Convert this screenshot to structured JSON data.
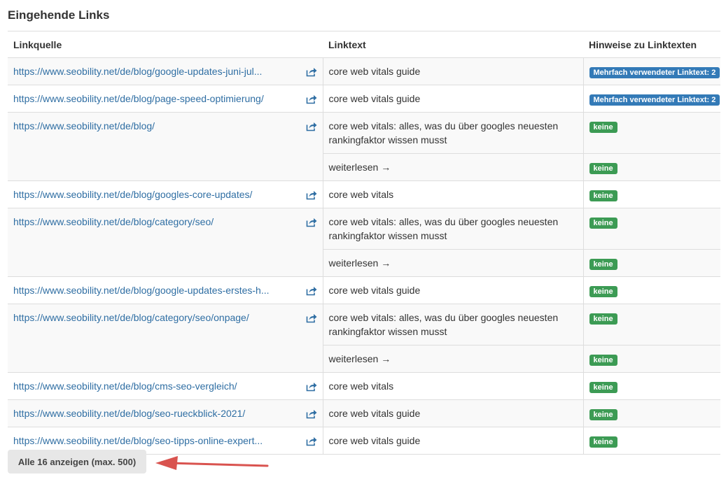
{
  "section": {
    "title": "Eingehende Links"
  },
  "table": {
    "headers": [
      "Linkquelle",
      "Linktext",
      "Hinweise zu Linktexten"
    ],
    "rows": [
      {
        "source": "https://www.seobility.net/de/blog/google-updates-juni-jul...",
        "entries": [
          {
            "text": "core web vitals guide",
            "badge": "Mehrfach verwendeter Linktext: 2",
            "badge_color": "#337ab7"
          }
        ]
      },
      {
        "source": "https://www.seobility.net/de/blog/page-speed-optimierung/",
        "entries": [
          {
            "text": "core web vitals guide",
            "badge": "Mehrfach verwendeter Linktext: 2",
            "badge_color": "#337ab7"
          }
        ]
      },
      {
        "source": "https://www.seobility.net/de/blog/",
        "entries": [
          {
            "text": "core web vitals: alles, was du über googles neuesten rankingfaktor wissen musst",
            "badge": "keine",
            "badge_color": "#3c9b54"
          },
          {
            "text": "weiterlesen →",
            "badge": "keine",
            "badge_color": "#3c9b54"
          }
        ]
      },
      {
        "source": "https://www.seobility.net/de/blog/googles-core-updates/",
        "entries": [
          {
            "text": "core web vitals",
            "badge": "keine",
            "badge_color": "#3c9b54"
          }
        ]
      },
      {
        "source": "https://www.seobility.net/de/blog/category/seo/",
        "entries": [
          {
            "text": "core web vitals: alles, was du über googles neuesten rankingfaktor wissen musst",
            "badge": "keine",
            "badge_color": "#3c9b54"
          },
          {
            "text": "weiterlesen →",
            "badge": "keine",
            "badge_color": "#3c9b54"
          }
        ]
      },
      {
        "source": "https://www.seobility.net/de/blog/google-updates-erstes-h...",
        "entries": [
          {
            "text": "core web vitals guide",
            "badge": "keine",
            "badge_color": "#3c9b54"
          }
        ]
      },
      {
        "source": "https://www.seobility.net/de/blog/category/seo/onpage/",
        "entries": [
          {
            "text": "core web vitals: alles, was du über googles neuesten rankingfaktor wissen musst",
            "badge": "keine",
            "badge_color": "#3c9b54"
          },
          {
            "text": "weiterlesen →",
            "badge": "keine",
            "badge_color": "#3c9b54"
          }
        ]
      },
      {
        "source": "https://www.seobility.net/de/blog/cms-seo-vergleich/",
        "entries": [
          {
            "text": "core web vitals",
            "badge": "keine",
            "badge_color": "#3c9b54"
          }
        ]
      },
      {
        "source": "https://www.seobility.net/de/blog/seo-rueckblick-2021/",
        "entries": [
          {
            "text": "core web vitals guide",
            "badge": "keine",
            "badge_color": "#3c9b54"
          }
        ]
      },
      {
        "source": "https://www.seobility.net/de/blog/seo-tipps-online-expert...",
        "entries": [
          {
            "text": "core web vitals guide",
            "badge": "keine",
            "badge_color": "#3c9b54"
          }
        ]
      }
    ]
  },
  "show_all_button": {
    "label": "Alle 16 anzeigen (max. 500)"
  },
  "icons": {
    "row_action": "share-external-icon",
    "annotation": "arrow-left-icon"
  },
  "colors": {
    "link": "#2f6ea3",
    "badge_blue": "#337ab7",
    "badge_green": "#3c9b54",
    "arrow": "#d9534f"
  }
}
